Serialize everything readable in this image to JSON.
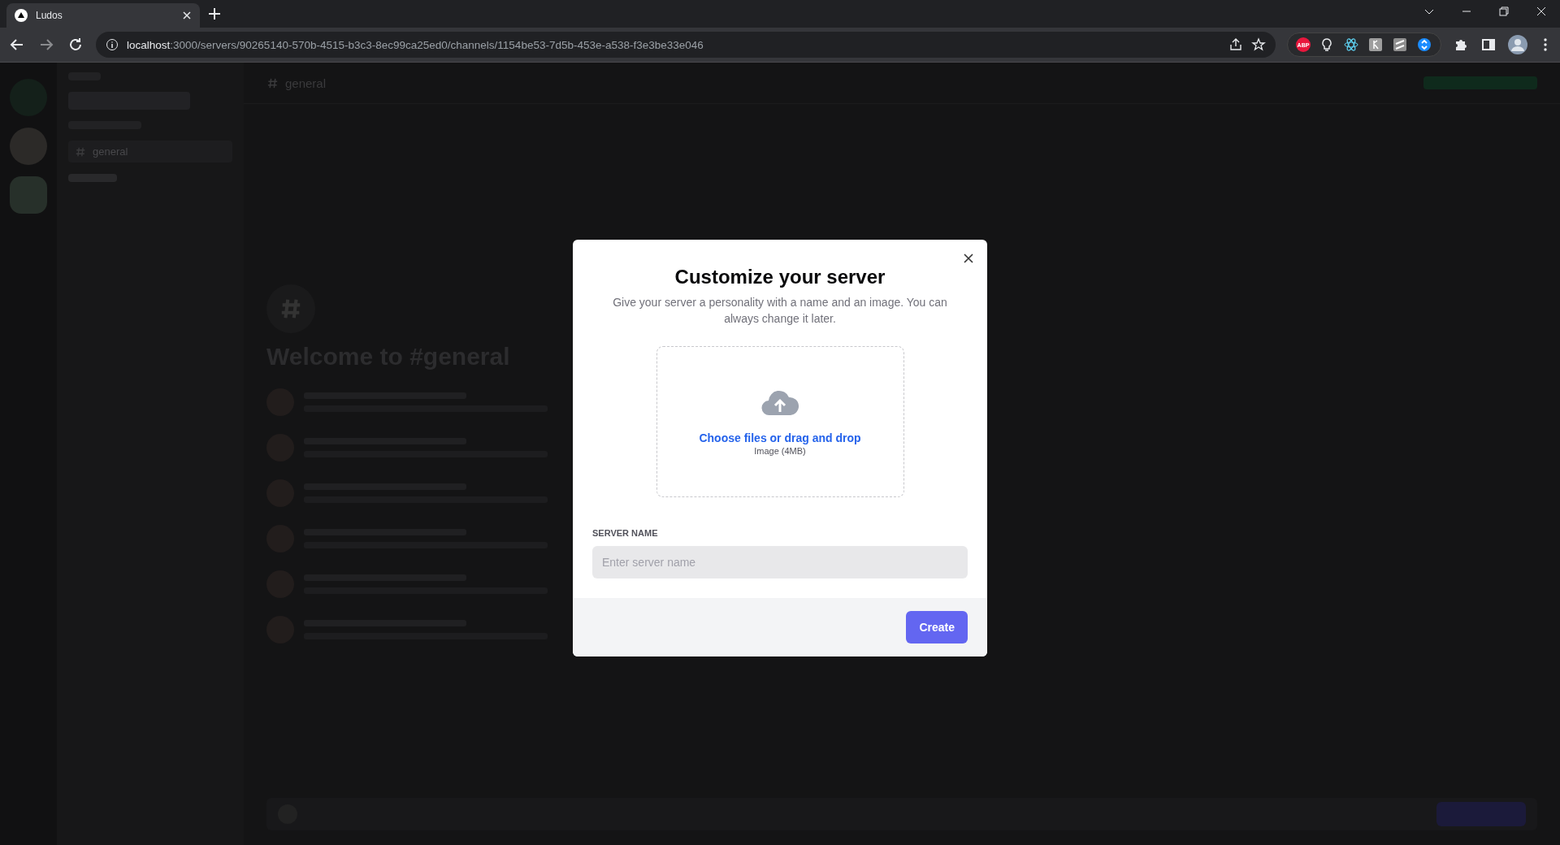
{
  "browser": {
    "tab": {
      "title": "Ludos"
    },
    "url": {
      "host": "localhost",
      "path": ":3000/servers/90265140-570b-4515-b3c3-8ec99ca25ed0/channels/1154be53-7d5b-453e-a538-f3e3be33e046"
    },
    "extensions": [
      {
        "label": "ABP",
        "color": "#e8173d"
      }
    ]
  },
  "background": {
    "channels": [
      {
        "name": "general",
        "selected": true
      }
    ],
    "channel_header": "general",
    "welcome_title": "Welcome to #general"
  },
  "modal": {
    "title": "Customize your server",
    "description": "Give your server a personality with a name and an image. You can always change it later.",
    "upload": {
      "link": "Choose files or drag and drop",
      "hint": "Image (4MB)"
    },
    "field": {
      "label": "SERVER NAME",
      "placeholder": "Enter server name"
    },
    "button": "Create"
  }
}
